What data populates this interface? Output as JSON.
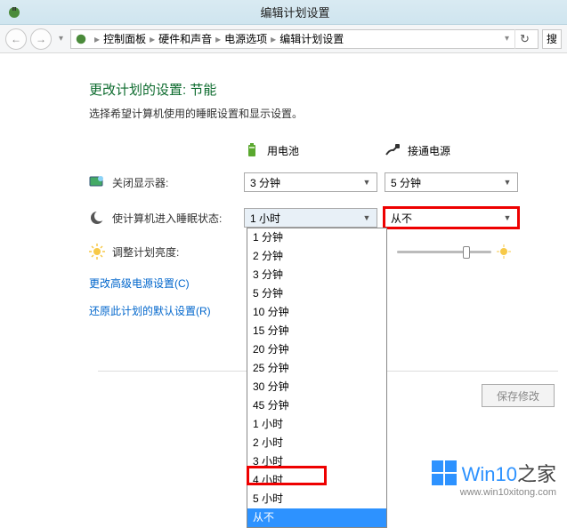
{
  "titlebar": {
    "title": "编辑计划设置"
  },
  "breadcrumb": {
    "items": [
      "控制面板",
      "硬件和声音",
      "电源选项",
      "编辑计划设置"
    ],
    "search_hint": "搜"
  },
  "page": {
    "heading": "更改计划的设置: 节能",
    "subheading": "选择希望计算机使用的睡眠设置和显示设置。"
  },
  "columns": {
    "battery": "用电池",
    "plugged": "接通电源"
  },
  "rows": {
    "display_off": {
      "label": "关闭显示器:",
      "battery": "3 分钟",
      "plugged": "5 分钟"
    },
    "sleep": {
      "label": "使计算机进入睡眠状态:",
      "battery": "1 小时",
      "plugged": "从不"
    },
    "brightness": {
      "label": "调整计划亮度:"
    }
  },
  "dropdown": {
    "items": [
      "1 分钟",
      "2 分钟",
      "3 分钟",
      "5 分钟",
      "10 分钟",
      "15 分钟",
      "20 分钟",
      "25 分钟",
      "30 分钟",
      "45 分钟",
      "1 小时",
      "2 小时",
      "3 小时",
      "4 小时",
      "5 小时",
      "从不"
    ],
    "selected": "从不"
  },
  "links": {
    "advanced": "更改高级电源设置(C)",
    "restore": "还原此计划的默认设置(R)"
  },
  "buttons": {
    "save": "保存修改"
  },
  "watermark": {
    "brand_a": "Win10",
    "brand_b": "之家",
    "url": "www.win10xitong.com"
  }
}
